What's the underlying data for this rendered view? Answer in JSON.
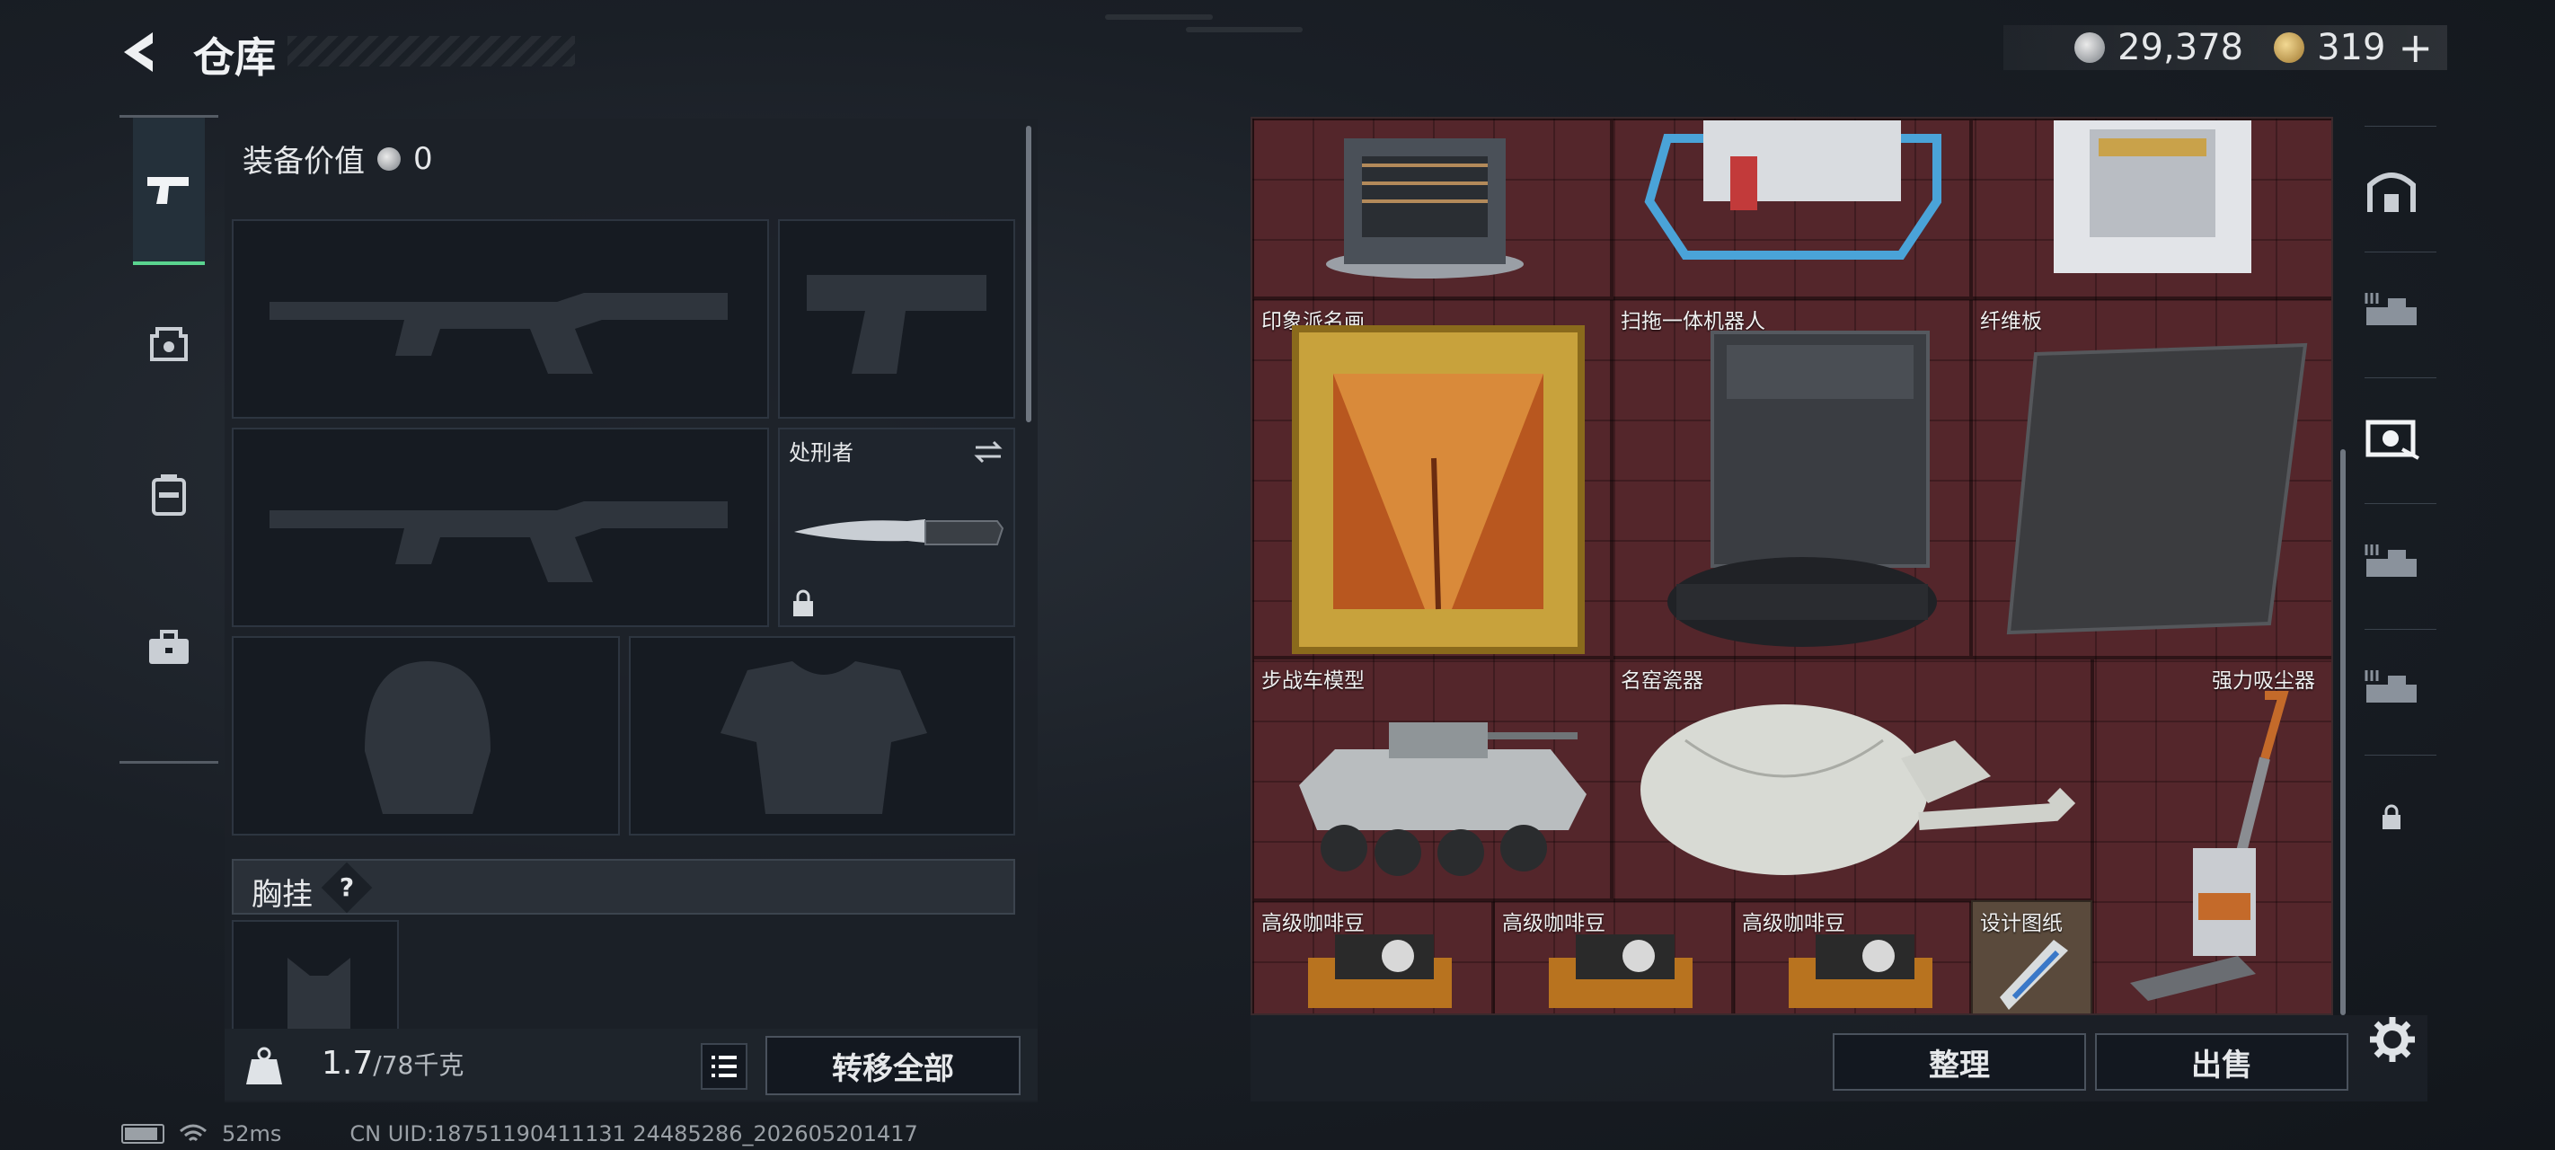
{
  "header": {
    "title": "仓库",
    "silver_amount": "29,378",
    "gold_amount": "319",
    "gold_add": "+"
  },
  "left_panel": {
    "equip_value_label": "装备价值",
    "equip_value": "0",
    "knife_name": "处刑者",
    "chest_label": "胸挂",
    "chest_help": "?",
    "weight": "1.7",
    "weight_max": "/78千克",
    "transfer_all": "转移全部"
  },
  "stash": {
    "items": [
      {
        "label": "印象派名画"
      },
      {
        "label": "扫拖一体机器人"
      },
      {
        "label": "纤维板"
      },
      {
        "label": "步战车模型"
      },
      {
        "label": "名窑瓷器"
      },
      {
        "label": "强力吸尘器"
      },
      {
        "label": "高级咖啡豆"
      },
      {
        "label": "高级咖啡豆"
      },
      {
        "label": "高级咖啡豆"
      },
      {
        "label": "设计图纸"
      }
    ],
    "sort_button": "整理",
    "sell_button": "出售"
  },
  "status_bar": {
    "ping": "52ms",
    "uid": "CN UID:18751190411131 24485286_202605201417"
  },
  "colors": {
    "stash_bg": "#54262b",
    "active_tab": "#5ad48f",
    "panel_bg": "#1c2128"
  }
}
